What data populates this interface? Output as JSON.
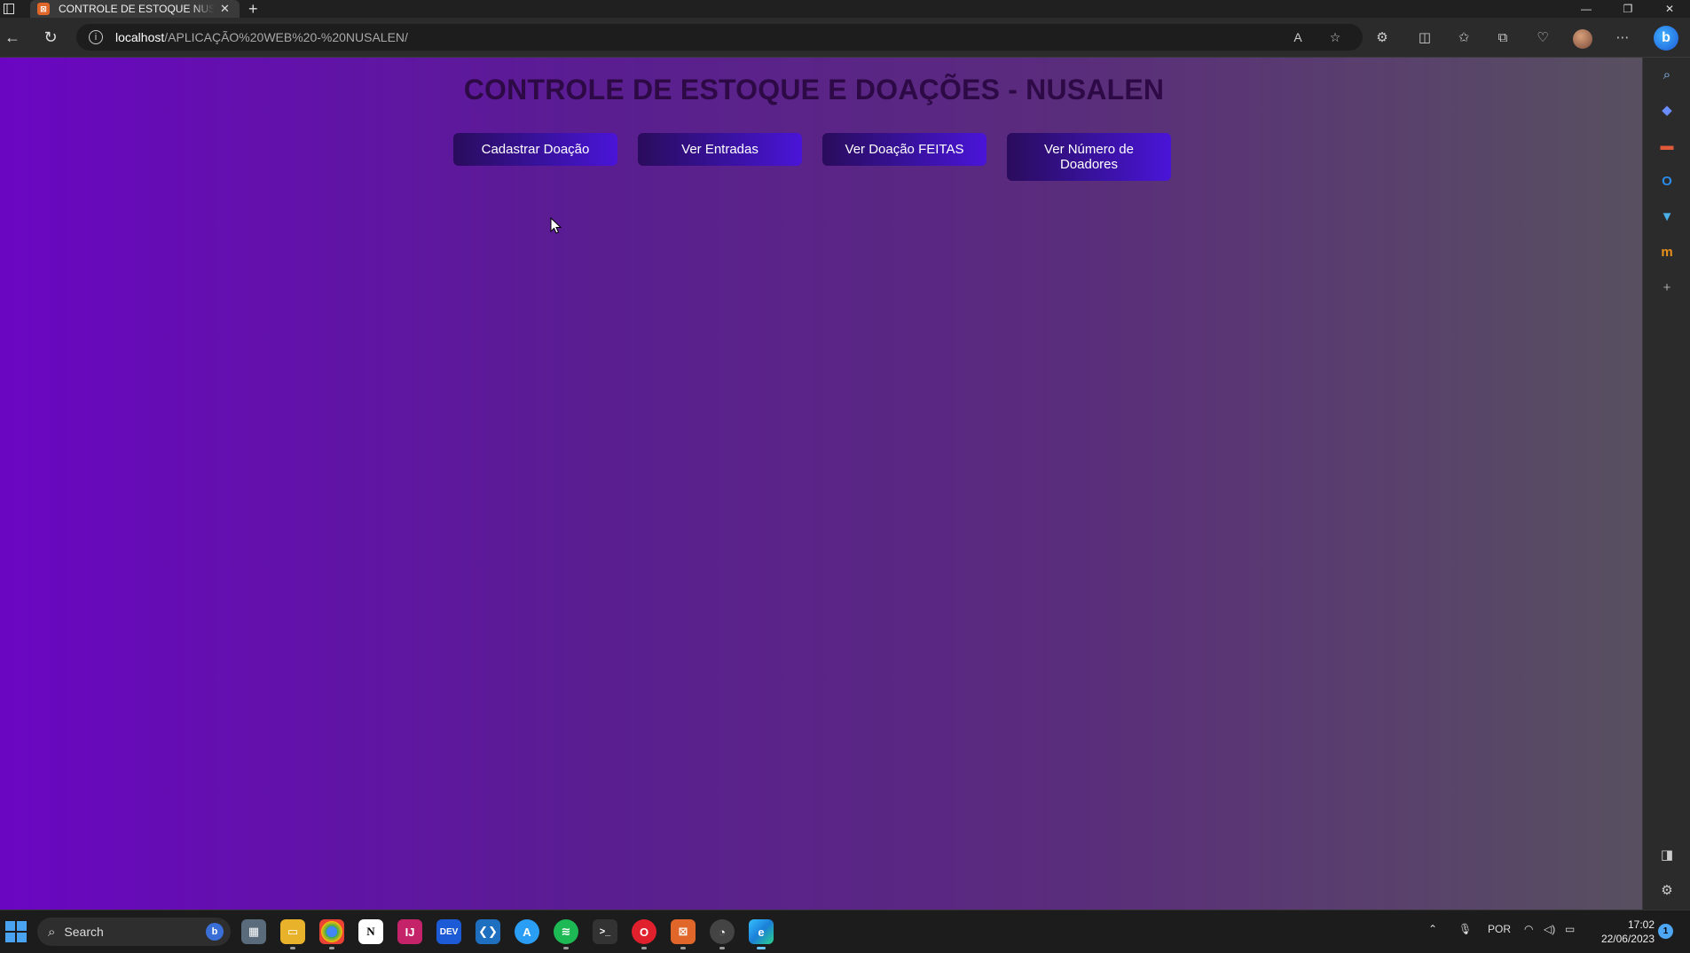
{
  "browser": {
    "tab_title": "CONTROLE DE ESTOQUE NUSALEN",
    "url_host": "localhost",
    "url_path": "/APLICAÇÃO%20WEB%20-%20NUSALEN/"
  },
  "page": {
    "title": "CONTROLE DE ESTOQUE E DOAÇÕES - NUSALEN",
    "buttons": [
      {
        "label": "Cadastrar Doação"
      },
      {
        "label": "Ver Entradas"
      },
      {
        "label": "Ver Doação FEITAS"
      },
      {
        "label": "Ver Número de Doadores"
      }
    ]
  },
  "taskbar": {
    "search_placeholder": "Search",
    "language": "POR",
    "time": "17:02",
    "date": "22/06/2023",
    "notification_count": "1"
  },
  "colors": {
    "page_gradient_start": "#6a06c2",
    "page_gradient_end": "#585060",
    "title_color": "#2d0a45",
    "button_gradient_start": "#2a0c5c",
    "button_gradient_end": "#4a14d8"
  }
}
